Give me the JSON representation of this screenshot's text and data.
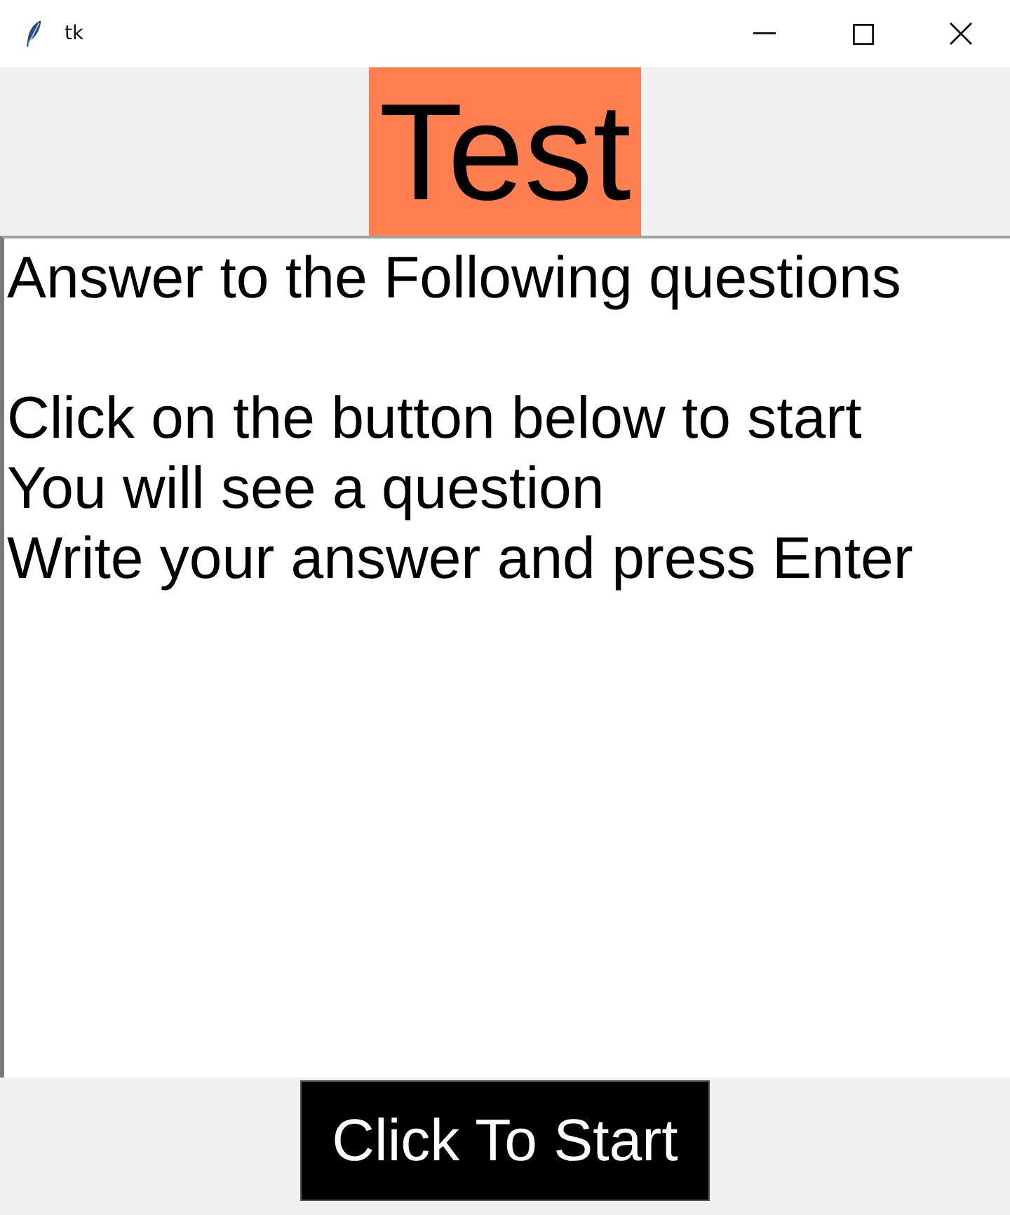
{
  "window": {
    "title": "tk"
  },
  "heading": {
    "text": "Test"
  },
  "text_area": {
    "paragraphs": [
      [
        "Answer to the Following questions"
      ],
      [
        "Click on the button below to start",
        "You will see a question",
        "Write your answer and press Enter"
      ]
    ]
  },
  "button": {
    "label": "Click To Start"
  }
}
